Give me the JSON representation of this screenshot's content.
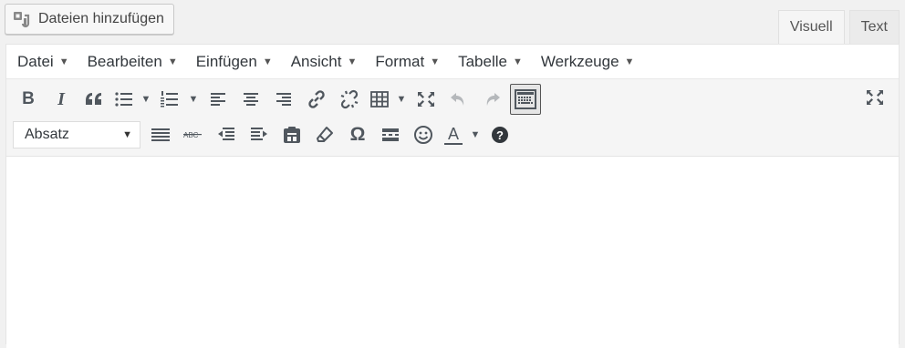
{
  "media": {
    "label": "Dateien hinzufügen",
    "icon": "media-add-icon"
  },
  "tabs": [
    {
      "label": "Visuell",
      "active": true
    },
    {
      "label": "Text",
      "active": false
    }
  ],
  "menubar": {
    "items": [
      {
        "label": "Datei"
      },
      {
        "label": "Bearbeiten"
      },
      {
        "label": "Einfügen"
      },
      {
        "label": "Ansicht"
      },
      {
        "label": "Format"
      },
      {
        "label": "Tabelle"
      },
      {
        "label": "Werkzeuge"
      }
    ],
    "caret": "▼"
  },
  "toolbar": {
    "bold": "B",
    "italic": "I",
    "blockquote": "❝",
    "format_select": "Absatz",
    "omega": "Ω",
    "textcolor": "A",
    "help": "?"
  },
  "colors": {
    "icon": "#50575e",
    "icon_disabled": "#b5b8bb",
    "toolbar_bg": "#f5f5f5",
    "page_bg": "#f1f1f1"
  }
}
